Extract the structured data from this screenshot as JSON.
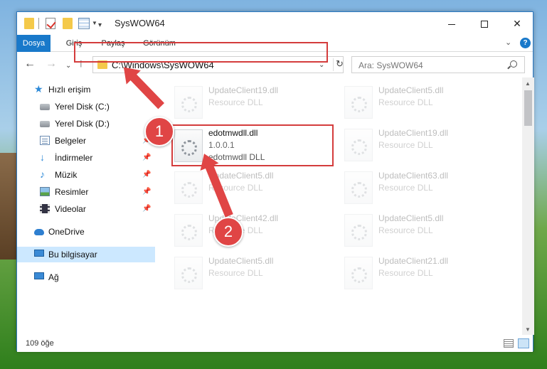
{
  "window": {
    "title": "SysWOW64",
    "controls": {
      "minimize": "minimize-icon",
      "maximize": "maximize-icon",
      "close": "close-icon"
    }
  },
  "ribbon": {
    "tabs": [
      "Dosya",
      "Giriş",
      "Paylaş",
      "Görünüm"
    ],
    "help": "?"
  },
  "navbar": {
    "address": "C:\\Windows\\SysWOW64",
    "search_placeholder": "Ara: SysWOW64"
  },
  "navpane": {
    "items": [
      {
        "label": "Hızlı erişim",
        "icon": "star-icon"
      },
      {
        "label": "Yerel Disk (C:)",
        "icon": "disk-icon"
      },
      {
        "label": "Yerel Disk (D:)",
        "icon": "disk-icon"
      },
      {
        "label": "Belgeler",
        "icon": "documents-icon",
        "pinned": true
      },
      {
        "label": "İndirmeler",
        "icon": "downloads-icon",
        "pinned": true
      },
      {
        "label": "Müzik",
        "icon": "music-icon",
        "pinned": true
      },
      {
        "label": "Resimler",
        "icon": "pictures-icon",
        "pinned": true
      },
      {
        "label": "Videolar",
        "icon": "videos-icon",
        "pinned": true
      },
      {
        "label": "OneDrive",
        "icon": "onedrive-icon"
      },
      {
        "label": "Bu bilgisayar",
        "icon": "this-pc-icon",
        "selected": true
      },
      {
        "label": "Ağ",
        "icon": "network-icon"
      }
    ]
  },
  "files": {
    "highlighted": {
      "name": "edotmwdll.dll",
      "version": "1.0.0.1",
      "description": "edotmwdll DLL"
    },
    "faded": [
      {
        "name": "UpdateClient19.dll",
        "description": "Resource DLL"
      },
      {
        "name": "UpdateClient5.dll",
        "description": "Resource DLL"
      },
      {
        "name": "UpdateClient19.dll",
        "description": "Resource DLL"
      },
      {
        "name": "UpdateClient5.dll",
        "description": "Resource DLL"
      },
      {
        "name": "UpdateClient63.dll",
        "description": "Resource DLL"
      },
      {
        "name": "UpdateClient42.dll",
        "description": "Resource DLL"
      },
      {
        "name": "UpdateClient5.dll",
        "description": "Resource DLL"
      },
      {
        "name": "UpdateClient5.dll",
        "description": "Resource DLL"
      },
      {
        "name": "UpdateClient21.dll",
        "description": "Resource DLL"
      }
    ]
  },
  "status": {
    "item_count": "109 öğe"
  },
  "annotations": {
    "step1": "1",
    "step2": "2",
    "color": "#e04545"
  }
}
